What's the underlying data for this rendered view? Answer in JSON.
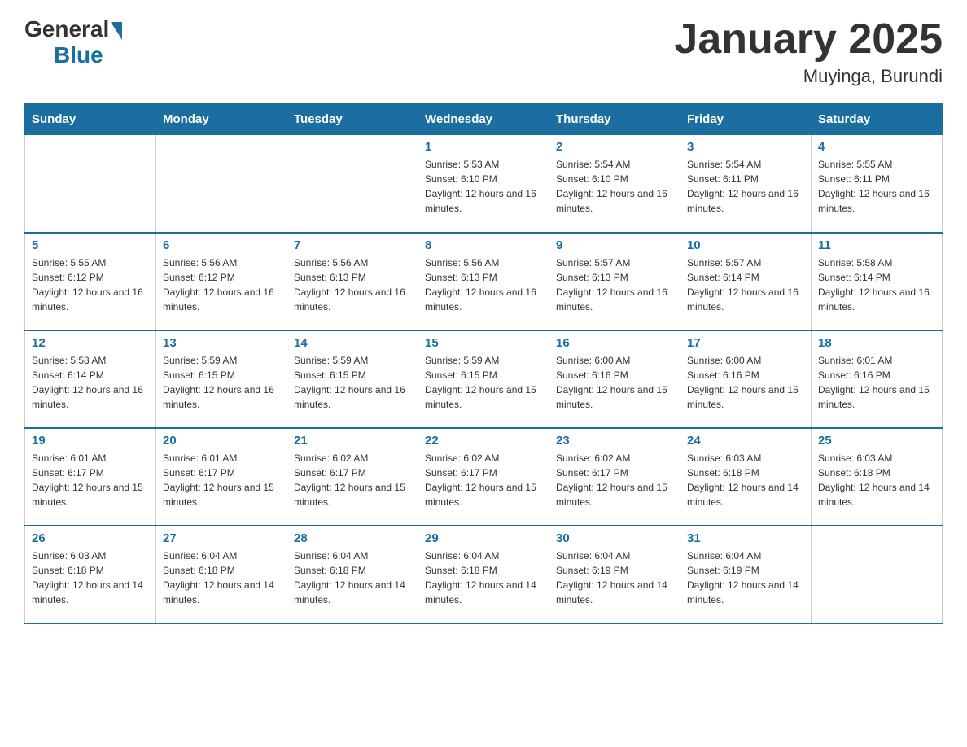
{
  "header": {
    "logo": {
      "general": "General",
      "blue": "Blue"
    },
    "title": "January 2025",
    "location": "Muyinga, Burundi"
  },
  "days_of_week": [
    "Sunday",
    "Monday",
    "Tuesday",
    "Wednesday",
    "Thursday",
    "Friday",
    "Saturday"
  ],
  "weeks": [
    [
      {
        "day": "",
        "sunrise": "",
        "sunset": "",
        "daylight": ""
      },
      {
        "day": "",
        "sunrise": "",
        "sunset": "",
        "daylight": ""
      },
      {
        "day": "",
        "sunrise": "",
        "sunset": "",
        "daylight": ""
      },
      {
        "day": "1",
        "sunrise": "Sunrise: 5:53 AM",
        "sunset": "Sunset: 6:10 PM",
        "daylight": "Daylight: 12 hours and 16 minutes."
      },
      {
        "day": "2",
        "sunrise": "Sunrise: 5:54 AM",
        "sunset": "Sunset: 6:10 PM",
        "daylight": "Daylight: 12 hours and 16 minutes."
      },
      {
        "day": "3",
        "sunrise": "Sunrise: 5:54 AM",
        "sunset": "Sunset: 6:11 PM",
        "daylight": "Daylight: 12 hours and 16 minutes."
      },
      {
        "day": "4",
        "sunrise": "Sunrise: 5:55 AM",
        "sunset": "Sunset: 6:11 PM",
        "daylight": "Daylight: 12 hours and 16 minutes."
      }
    ],
    [
      {
        "day": "5",
        "sunrise": "Sunrise: 5:55 AM",
        "sunset": "Sunset: 6:12 PM",
        "daylight": "Daylight: 12 hours and 16 minutes."
      },
      {
        "day": "6",
        "sunrise": "Sunrise: 5:56 AM",
        "sunset": "Sunset: 6:12 PM",
        "daylight": "Daylight: 12 hours and 16 minutes."
      },
      {
        "day": "7",
        "sunrise": "Sunrise: 5:56 AM",
        "sunset": "Sunset: 6:13 PM",
        "daylight": "Daylight: 12 hours and 16 minutes."
      },
      {
        "day": "8",
        "sunrise": "Sunrise: 5:56 AM",
        "sunset": "Sunset: 6:13 PM",
        "daylight": "Daylight: 12 hours and 16 minutes."
      },
      {
        "day": "9",
        "sunrise": "Sunrise: 5:57 AM",
        "sunset": "Sunset: 6:13 PM",
        "daylight": "Daylight: 12 hours and 16 minutes."
      },
      {
        "day": "10",
        "sunrise": "Sunrise: 5:57 AM",
        "sunset": "Sunset: 6:14 PM",
        "daylight": "Daylight: 12 hours and 16 minutes."
      },
      {
        "day": "11",
        "sunrise": "Sunrise: 5:58 AM",
        "sunset": "Sunset: 6:14 PM",
        "daylight": "Daylight: 12 hours and 16 minutes."
      }
    ],
    [
      {
        "day": "12",
        "sunrise": "Sunrise: 5:58 AM",
        "sunset": "Sunset: 6:14 PM",
        "daylight": "Daylight: 12 hours and 16 minutes."
      },
      {
        "day": "13",
        "sunrise": "Sunrise: 5:59 AM",
        "sunset": "Sunset: 6:15 PM",
        "daylight": "Daylight: 12 hours and 16 minutes."
      },
      {
        "day": "14",
        "sunrise": "Sunrise: 5:59 AM",
        "sunset": "Sunset: 6:15 PM",
        "daylight": "Daylight: 12 hours and 16 minutes."
      },
      {
        "day": "15",
        "sunrise": "Sunrise: 5:59 AM",
        "sunset": "Sunset: 6:15 PM",
        "daylight": "Daylight: 12 hours and 15 minutes."
      },
      {
        "day": "16",
        "sunrise": "Sunrise: 6:00 AM",
        "sunset": "Sunset: 6:16 PM",
        "daylight": "Daylight: 12 hours and 15 minutes."
      },
      {
        "day": "17",
        "sunrise": "Sunrise: 6:00 AM",
        "sunset": "Sunset: 6:16 PM",
        "daylight": "Daylight: 12 hours and 15 minutes."
      },
      {
        "day": "18",
        "sunrise": "Sunrise: 6:01 AM",
        "sunset": "Sunset: 6:16 PM",
        "daylight": "Daylight: 12 hours and 15 minutes."
      }
    ],
    [
      {
        "day": "19",
        "sunrise": "Sunrise: 6:01 AM",
        "sunset": "Sunset: 6:17 PM",
        "daylight": "Daylight: 12 hours and 15 minutes."
      },
      {
        "day": "20",
        "sunrise": "Sunrise: 6:01 AM",
        "sunset": "Sunset: 6:17 PM",
        "daylight": "Daylight: 12 hours and 15 minutes."
      },
      {
        "day": "21",
        "sunrise": "Sunrise: 6:02 AM",
        "sunset": "Sunset: 6:17 PM",
        "daylight": "Daylight: 12 hours and 15 minutes."
      },
      {
        "day": "22",
        "sunrise": "Sunrise: 6:02 AM",
        "sunset": "Sunset: 6:17 PM",
        "daylight": "Daylight: 12 hours and 15 minutes."
      },
      {
        "day": "23",
        "sunrise": "Sunrise: 6:02 AM",
        "sunset": "Sunset: 6:17 PM",
        "daylight": "Daylight: 12 hours and 15 minutes."
      },
      {
        "day": "24",
        "sunrise": "Sunrise: 6:03 AM",
        "sunset": "Sunset: 6:18 PM",
        "daylight": "Daylight: 12 hours and 14 minutes."
      },
      {
        "day": "25",
        "sunrise": "Sunrise: 6:03 AM",
        "sunset": "Sunset: 6:18 PM",
        "daylight": "Daylight: 12 hours and 14 minutes."
      }
    ],
    [
      {
        "day": "26",
        "sunrise": "Sunrise: 6:03 AM",
        "sunset": "Sunset: 6:18 PM",
        "daylight": "Daylight: 12 hours and 14 minutes."
      },
      {
        "day": "27",
        "sunrise": "Sunrise: 6:04 AM",
        "sunset": "Sunset: 6:18 PM",
        "daylight": "Daylight: 12 hours and 14 minutes."
      },
      {
        "day": "28",
        "sunrise": "Sunrise: 6:04 AM",
        "sunset": "Sunset: 6:18 PM",
        "daylight": "Daylight: 12 hours and 14 minutes."
      },
      {
        "day": "29",
        "sunrise": "Sunrise: 6:04 AM",
        "sunset": "Sunset: 6:18 PM",
        "daylight": "Daylight: 12 hours and 14 minutes."
      },
      {
        "day": "30",
        "sunrise": "Sunrise: 6:04 AM",
        "sunset": "Sunset: 6:19 PM",
        "daylight": "Daylight: 12 hours and 14 minutes."
      },
      {
        "day": "31",
        "sunrise": "Sunrise: 6:04 AM",
        "sunset": "Sunset: 6:19 PM",
        "daylight": "Daylight: 12 hours and 14 minutes."
      },
      {
        "day": "",
        "sunrise": "",
        "sunset": "",
        "daylight": ""
      }
    ]
  ]
}
